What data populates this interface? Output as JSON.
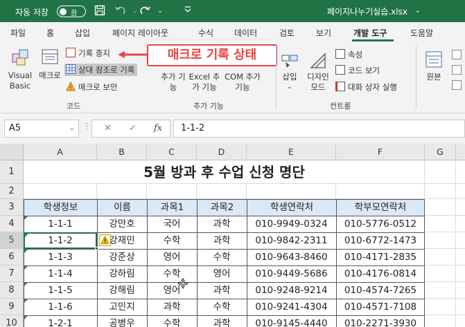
{
  "titlebar": {
    "autosave_label": "자동 저장",
    "autosave_state": "끔",
    "filename": "페이지나누기실습.xlsx"
  },
  "tabs": [
    "파일",
    "홈",
    "삽입",
    "페이지 레이아웃",
    "수식",
    "데이터",
    "검토",
    "보기",
    "개발 도구",
    "도움말"
  ],
  "active_tab": "개발 도구",
  "ribbon": {
    "visual_basic": "Visual Basic",
    "macro": "매크로",
    "record_stop": "기록 중지",
    "relative_ref": "상대 참조로 기록",
    "macro_security": "매크로 보안",
    "code_group": "코드",
    "addins": "추가 기능",
    "excel_addins": "Excel 추가 기능",
    "com_addins": "COM 추가 기능",
    "addins_group": "추가 기능",
    "insert": "삽입",
    "design_mode": "디자인 모드",
    "properties": "속성",
    "view_code": "코드 보기",
    "run_dialog": "대화 상자 실행",
    "controls_group": "컨트롤",
    "source": "원본"
  },
  "annotation": "매크로 기록 상태",
  "formula_bar": {
    "name_box": "A5",
    "formula": "1-1-2",
    "fx": "fx"
  },
  "sheet": {
    "columns": [
      "A",
      "B",
      "C",
      "D",
      "E",
      "F",
      "G"
    ],
    "rows": [
      "1",
      "2",
      "3",
      "4",
      "5",
      "6",
      "7",
      "8",
      "9",
      "10"
    ],
    "title": "5월 방과 후 수업 신청 명단",
    "headers": [
      "학생정보",
      "이름",
      "과목1",
      "과목2",
      "학생연락처",
      "학부모연락처"
    ],
    "data": [
      [
        "1-1-1",
        "강만호",
        "국어",
        "과학",
        "010-9949-0324",
        "010-5776-0512"
      ],
      [
        "1-1-2",
        "강재민",
        "수학",
        "과학",
        "010-9842-2311",
        "010-6772-1473"
      ],
      [
        "1-1-3",
        "강준상",
        "영어",
        "수학",
        "010-9643-8460",
        "010-4171-2835"
      ],
      [
        "1-1-4",
        "강하림",
        "수학",
        "영어",
        "010-9449-5686",
        "010-4176-0814"
      ],
      [
        "1-1-5",
        "강해림",
        "영어",
        "과학",
        "010-9248-9214",
        "010-4574-7265"
      ],
      [
        "1-1-6",
        "고민지",
        "과학",
        "수학",
        "010-9241-4304",
        "010-4571-7108"
      ],
      [
        "1-2-1",
        "공병우",
        "수학",
        "과학",
        "010-9145-4440",
        "010-2271-3930"
      ]
    ]
  },
  "colors": {
    "excel_green": "#217346",
    "annotation_red": "#e84343",
    "header_fill": "#dbe8f6"
  }
}
